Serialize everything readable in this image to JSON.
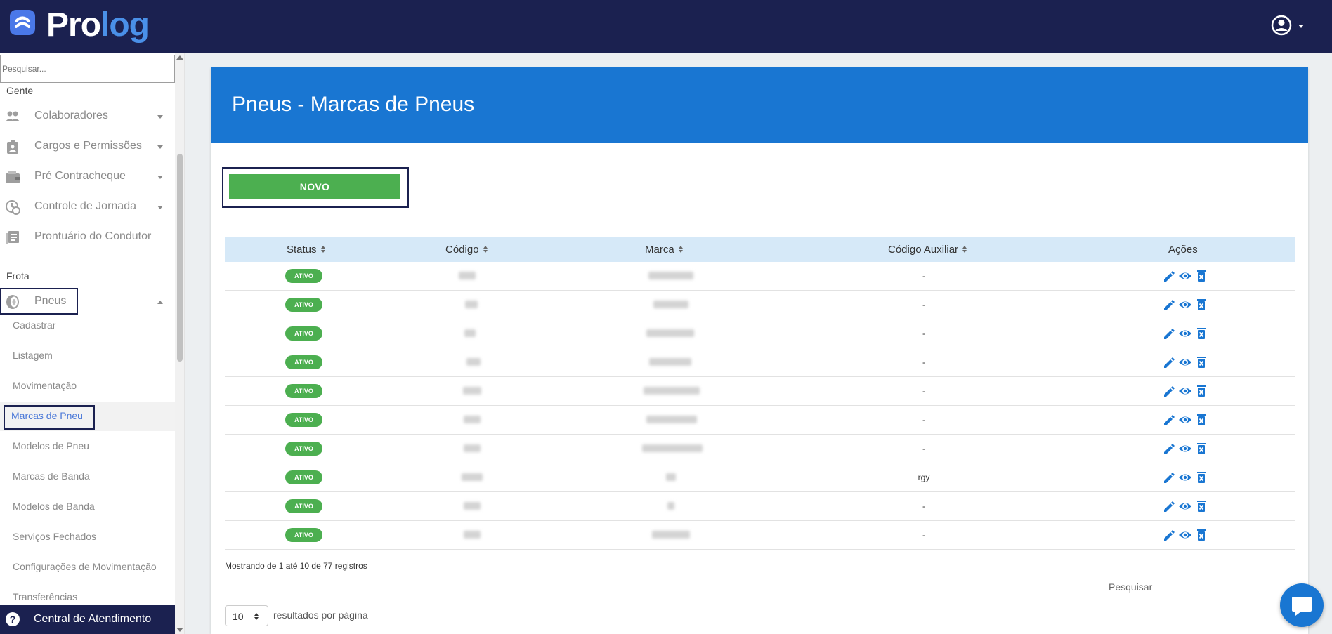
{
  "app": {
    "logo_prefix": "Pro",
    "logo_suffix": "log"
  },
  "sidebar": {
    "search_placeholder": "Pesquisar...",
    "section_gente": "Gente",
    "gente_items": [
      {
        "label": "Colaboradores",
        "icon": "people-icon"
      },
      {
        "label": "Cargos e Permissões",
        "icon": "badge-icon"
      },
      {
        "label": "Pré Contracheque",
        "icon": "wallet-icon"
      },
      {
        "label": "Controle de Jornada",
        "icon": "clock-icon"
      },
      {
        "label": "Prontuário do Condutor",
        "icon": "records-icon"
      }
    ],
    "section_frota": "Frota",
    "pneus_label": "Pneus",
    "pneus_subitems": [
      "Cadastrar",
      "Listagem",
      "Movimentação",
      "Marcas de Pneu",
      "Modelos de Pneu",
      "Marcas de Banda",
      "Modelos de Banda",
      "Serviços Fechados",
      "Configurações de Movimentação",
      "Transferências"
    ],
    "active_subitem": "Marcas de Pneu",
    "help_label": "Central de Atendimento"
  },
  "main": {
    "title": "Pneus - Marcas de Pneus",
    "novo_label": "NOVO",
    "columns": [
      "Status",
      "Código",
      "Marca",
      "Código Auxiliar",
      "Ações"
    ],
    "rows": [
      {
        "status": "ATIVO",
        "aux": "-"
      },
      {
        "status": "ATIVO",
        "aux": "-"
      },
      {
        "status": "ATIVO",
        "aux": "-"
      },
      {
        "status": "ATIVO",
        "aux": "-"
      },
      {
        "status": "ATIVO",
        "aux": "-"
      },
      {
        "status": "ATIVO",
        "aux": "-"
      },
      {
        "status": "ATIVO",
        "aux": "-"
      },
      {
        "status": "ATIVO",
        "aux": "rgy"
      },
      {
        "status": "ATIVO",
        "aux": "-"
      },
      {
        "status": "ATIVO",
        "aux": "-"
      }
    ],
    "info_text": "Mostrando de 1 até 10 de 77 registros",
    "search_label": "Pesquisar",
    "page_size": "10",
    "page_size_label": "resultados por página"
  },
  "colors": {
    "topbar": "#1b2150",
    "header": "#1976d2",
    "success": "#4caf50",
    "action": "#1976d2",
    "active_link": "#4a78d8"
  }
}
